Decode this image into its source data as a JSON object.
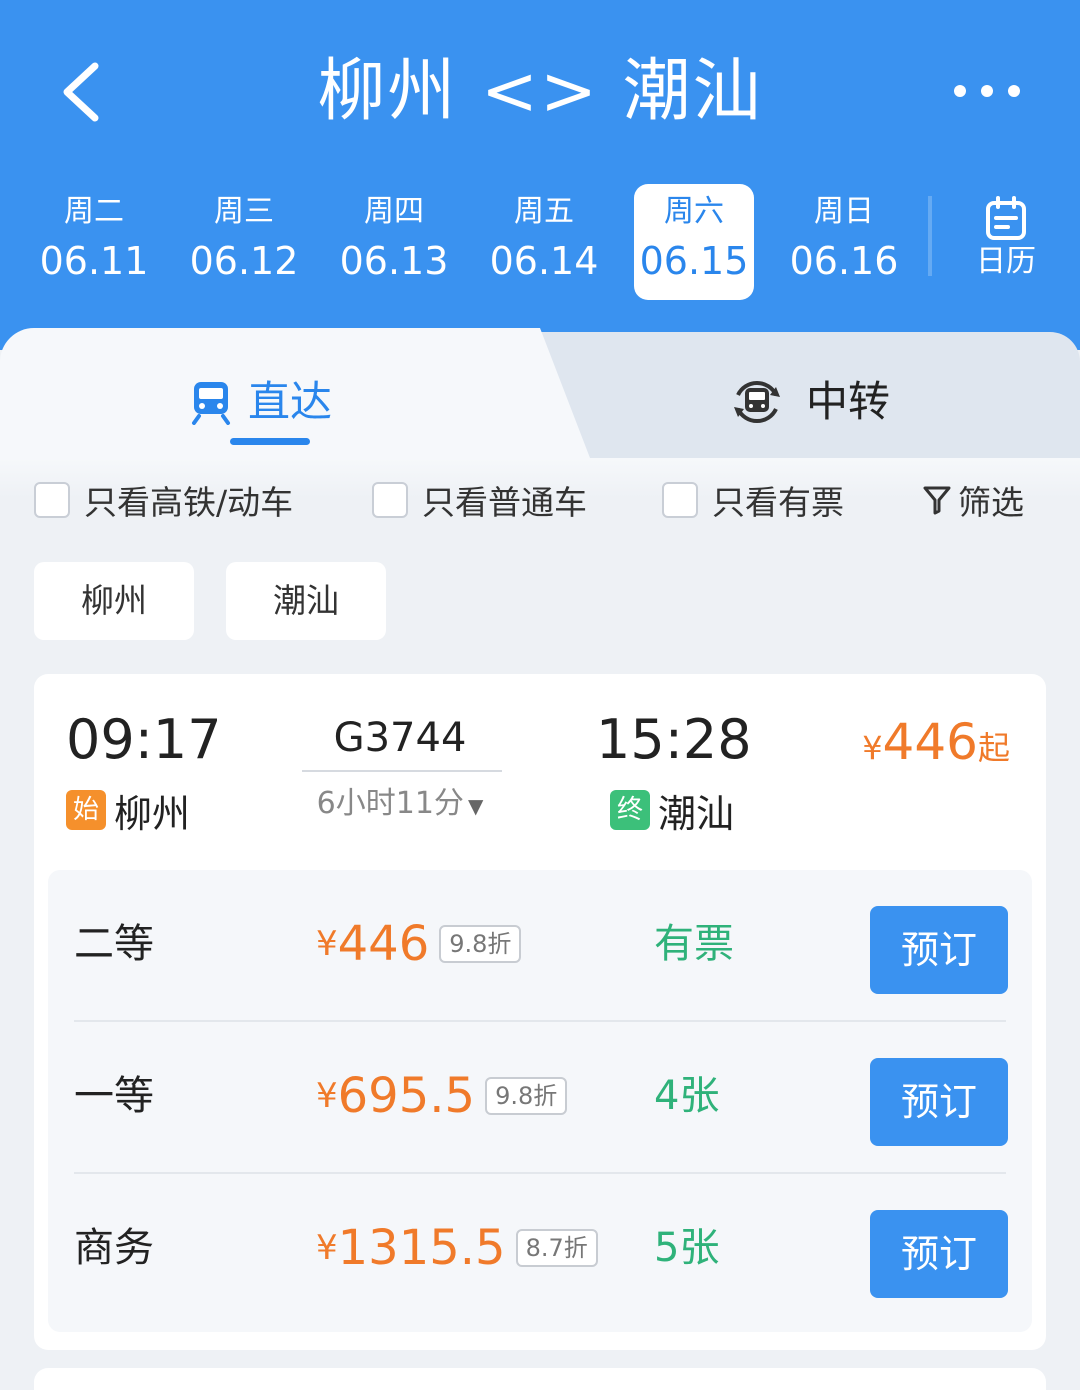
{
  "header": {
    "title": "柳州 <> 潮汕",
    "back_icon": "chevron-left-icon",
    "more_icon": "more-dots-icon",
    "dates": [
      {
        "weekday": "周二",
        "date": "06.11",
        "active": false
      },
      {
        "weekday": "周三",
        "date": "06.12",
        "active": false
      },
      {
        "weekday": "周四",
        "date": "06.13",
        "active": false
      },
      {
        "weekday": "周五",
        "date": "06.14",
        "active": false
      },
      {
        "weekday": "周六",
        "date": "06.15",
        "active": true
      },
      {
        "weekday": "周日",
        "date": "06.16",
        "active": false
      }
    ],
    "calendar_label": "日历"
  },
  "tabs": {
    "direct": "直达",
    "transfer": "中转"
  },
  "filters": {
    "high_speed_only": "只看高铁/动车",
    "regular_only": "只看普通车",
    "available_only": "只看有票",
    "filter_label": "筛选"
  },
  "stations": {
    "from": "柳州",
    "to": "潮汕"
  },
  "train": {
    "departure_time": "09:17",
    "departure_badge": "始",
    "departure_station": "柳州",
    "train_number": "G3744",
    "duration": "6小时11分",
    "arrival_time": "15:28",
    "arrival_badge": "终",
    "arrival_station": "潮汕",
    "min_price_symbol": "¥",
    "min_price": "446",
    "min_price_suffix": "起",
    "seats": [
      {
        "name": "二等",
        "symbol": "¥",
        "price": "446",
        "discount": "9.8折",
        "availability": "有票",
        "book": "预订"
      },
      {
        "name": "一等",
        "symbol": "¥",
        "price": "695.5",
        "discount": "9.8折",
        "availability": "4张",
        "book": "预订"
      },
      {
        "name": "商务",
        "symbol": "¥",
        "price": "1315.5",
        "discount": "8.7折",
        "availability": "5张",
        "book": "预订"
      }
    ]
  },
  "colors": {
    "primary": "#3a92f0",
    "price": "#f07a2a",
    "available": "#2fb27a",
    "start_badge": "#f5902c",
    "end_badge": "#3cc07a"
  }
}
